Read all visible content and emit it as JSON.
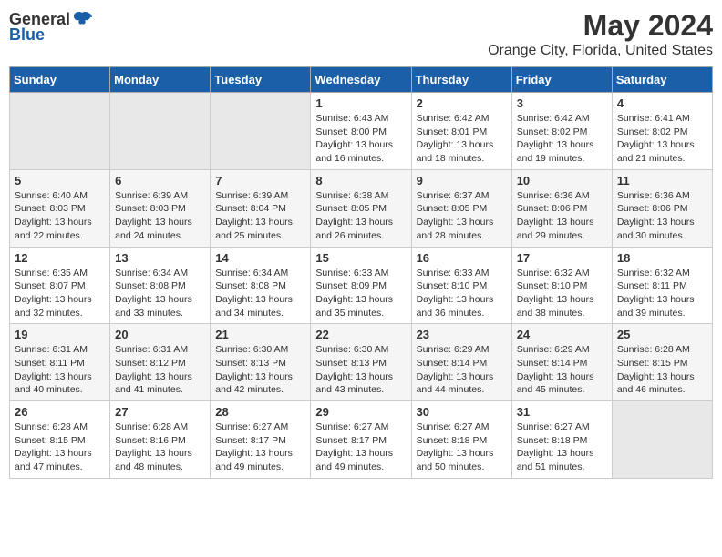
{
  "logo": {
    "general": "General",
    "blue": "Blue"
  },
  "title": "May 2024",
  "subtitle": "Orange City, Florida, United States",
  "days_of_week": [
    "Sunday",
    "Monday",
    "Tuesday",
    "Wednesday",
    "Thursday",
    "Friday",
    "Saturday"
  ],
  "weeks": [
    [
      {
        "day": "",
        "empty": true
      },
      {
        "day": "",
        "empty": true
      },
      {
        "day": "",
        "empty": true
      },
      {
        "day": "1",
        "sunrise": "6:43 AM",
        "sunset": "8:00 PM",
        "daylight": "13 hours and 16 minutes."
      },
      {
        "day": "2",
        "sunrise": "6:42 AM",
        "sunset": "8:01 PM",
        "daylight": "13 hours and 18 minutes."
      },
      {
        "day": "3",
        "sunrise": "6:42 AM",
        "sunset": "8:02 PM",
        "daylight": "13 hours and 19 minutes."
      },
      {
        "day": "4",
        "sunrise": "6:41 AM",
        "sunset": "8:02 PM",
        "daylight": "13 hours and 21 minutes."
      }
    ],
    [
      {
        "day": "5",
        "sunrise": "6:40 AM",
        "sunset": "8:03 PM",
        "daylight": "13 hours and 22 minutes."
      },
      {
        "day": "6",
        "sunrise": "6:39 AM",
        "sunset": "8:03 PM",
        "daylight": "13 hours and 24 minutes."
      },
      {
        "day": "7",
        "sunrise": "6:39 AM",
        "sunset": "8:04 PM",
        "daylight": "13 hours and 25 minutes."
      },
      {
        "day": "8",
        "sunrise": "6:38 AM",
        "sunset": "8:05 PM",
        "daylight": "13 hours and 26 minutes."
      },
      {
        "day": "9",
        "sunrise": "6:37 AM",
        "sunset": "8:05 PM",
        "daylight": "13 hours and 28 minutes."
      },
      {
        "day": "10",
        "sunrise": "6:36 AM",
        "sunset": "8:06 PM",
        "daylight": "13 hours and 29 minutes."
      },
      {
        "day": "11",
        "sunrise": "6:36 AM",
        "sunset": "8:06 PM",
        "daylight": "13 hours and 30 minutes."
      }
    ],
    [
      {
        "day": "12",
        "sunrise": "6:35 AM",
        "sunset": "8:07 PM",
        "daylight": "13 hours and 32 minutes."
      },
      {
        "day": "13",
        "sunrise": "6:34 AM",
        "sunset": "8:08 PM",
        "daylight": "13 hours and 33 minutes."
      },
      {
        "day": "14",
        "sunrise": "6:34 AM",
        "sunset": "8:08 PM",
        "daylight": "13 hours and 34 minutes."
      },
      {
        "day": "15",
        "sunrise": "6:33 AM",
        "sunset": "8:09 PM",
        "daylight": "13 hours and 35 minutes."
      },
      {
        "day": "16",
        "sunrise": "6:33 AM",
        "sunset": "8:10 PM",
        "daylight": "13 hours and 36 minutes."
      },
      {
        "day": "17",
        "sunrise": "6:32 AM",
        "sunset": "8:10 PM",
        "daylight": "13 hours and 38 minutes."
      },
      {
        "day": "18",
        "sunrise": "6:32 AM",
        "sunset": "8:11 PM",
        "daylight": "13 hours and 39 minutes."
      }
    ],
    [
      {
        "day": "19",
        "sunrise": "6:31 AM",
        "sunset": "8:11 PM",
        "daylight": "13 hours and 40 minutes."
      },
      {
        "day": "20",
        "sunrise": "6:31 AM",
        "sunset": "8:12 PM",
        "daylight": "13 hours and 41 minutes."
      },
      {
        "day": "21",
        "sunrise": "6:30 AM",
        "sunset": "8:13 PM",
        "daylight": "13 hours and 42 minutes."
      },
      {
        "day": "22",
        "sunrise": "6:30 AM",
        "sunset": "8:13 PM",
        "daylight": "13 hours and 43 minutes."
      },
      {
        "day": "23",
        "sunrise": "6:29 AM",
        "sunset": "8:14 PM",
        "daylight": "13 hours and 44 minutes."
      },
      {
        "day": "24",
        "sunrise": "6:29 AM",
        "sunset": "8:14 PM",
        "daylight": "13 hours and 45 minutes."
      },
      {
        "day": "25",
        "sunrise": "6:28 AM",
        "sunset": "8:15 PM",
        "daylight": "13 hours and 46 minutes."
      }
    ],
    [
      {
        "day": "26",
        "sunrise": "6:28 AM",
        "sunset": "8:15 PM",
        "daylight": "13 hours and 47 minutes."
      },
      {
        "day": "27",
        "sunrise": "6:28 AM",
        "sunset": "8:16 PM",
        "daylight": "13 hours and 48 minutes."
      },
      {
        "day": "28",
        "sunrise": "6:27 AM",
        "sunset": "8:17 PM",
        "daylight": "13 hours and 49 minutes."
      },
      {
        "day": "29",
        "sunrise": "6:27 AM",
        "sunset": "8:17 PM",
        "daylight": "13 hours and 49 minutes."
      },
      {
        "day": "30",
        "sunrise": "6:27 AM",
        "sunset": "8:18 PM",
        "daylight": "13 hours and 50 minutes."
      },
      {
        "day": "31",
        "sunrise": "6:27 AM",
        "sunset": "8:18 PM",
        "daylight": "13 hours and 51 minutes."
      },
      {
        "day": "",
        "empty": true
      }
    ]
  ],
  "labels": {
    "sunrise": "Sunrise:",
    "sunset": "Sunset:",
    "daylight": "Daylight:"
  }
}
